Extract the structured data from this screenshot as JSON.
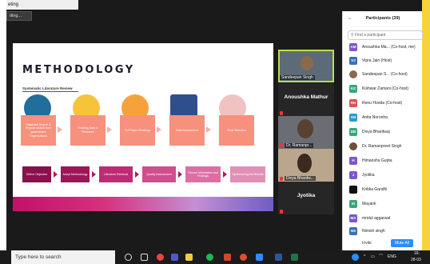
{
  "window": {
    "title": "eting",
    "view_button": "ding..."
  },
  "slide": {
    "title": "METHODOLOGY",
    "subtitle": "Systematic Literature Review",
    "steps": [
      "Database Search & Regular search from government Organizations",
      "Reading Data & Research",
      "Full Paper Readings",
      "Data Assessment",
      "Final Selection"
    ],
    "flow": [
      "Define Objective",
      "Adopt Methodology",
      "Literature Retrieval",
      "Quality Assessment",
      "Record Information and Findings",
      "Synthesizing the Results"
    ]
  },
  "video_tiles": [
    {
      "name": "Sandeepan Singh",
      "type": "video"
    },
    {
      "name": "Anoushka Mathur",
      "type": "name"
    },
    {
      "name": "Dr. Ramanpr...",
      "type": "video"
    },
    {
      "name": "Divya Bhardw...",
      "type": "video"
    },
    {
      "name": "Jyotika",
      "type": "name"
    }
  ],
  "participants_panel": {
    "title": "Participants (39)",
    "search_placeholder": "Find a participant",
    "invite_label": "Invite",
    "mute_all_label": "Mute All",
    "items": [
      {
        "initials": "AM",
        "name": "Anoushka Ma... (Co-host, me)",
        "color": "#7b57c9"
      },
      {
        "initials": "VJ",
        "name": "Vipra Jain (Host)",
        "color": "#3b6fb6"
      },
      {
        "initials": "",
        "name": "Sandeepan S... (Co-host)",
        "color": "#8a6a4a"
      },
      {
        "initials": "KZ",
        "name": "Kishwar Zamani (Co-host)",
        "color": "#3aa67a"
      },
      {
        "initials": "RH",
        "name": "Renu Hooda (Co-host)",
        "color": "#d9534f"
      },
      {
        "initials": "AN",
        "name": "Anita Noronha",
        "color": "#2e9ad0"
      },
      {
        "initials": "DB",
        "name": "Divya Bhardwaj",
        "color": "#3aa67a"
      },
      {
        "initials": "",
        "name": "Dr. Ramanpreet Singh",
        "color": "#6b4f3a"
      },
      {
        "initials": "H",
        "name": "Himanshu Gupta",
        "color": "#7b57c9"
      },
      {
        "initials": "J",
        "name": "Jyotika",
        "color": "#7b57c9"
      },
      {
        "initials": "",
        "name": "Kritika Gandhi",
        "color": "#111111"
      },
      {
        "initials": "M",
        "name": "Mayank",
        "color": "#3aa67a"
      },
      {
        "initials": "MA",
        "name": "mridul aggarwal",
        "color": "#7b57c9"
      },
      {
        "initials": "NS",
        "name": "Nimish singh",
        "color": "#3b6fb6"
      }
    ]
  },
  "taskbar": {
    "search_placeholder": "Type here to search",
    "tray_language": "ENG",
    "tray_time": "16:",
    "tray_date": "28-03"
  }
}
